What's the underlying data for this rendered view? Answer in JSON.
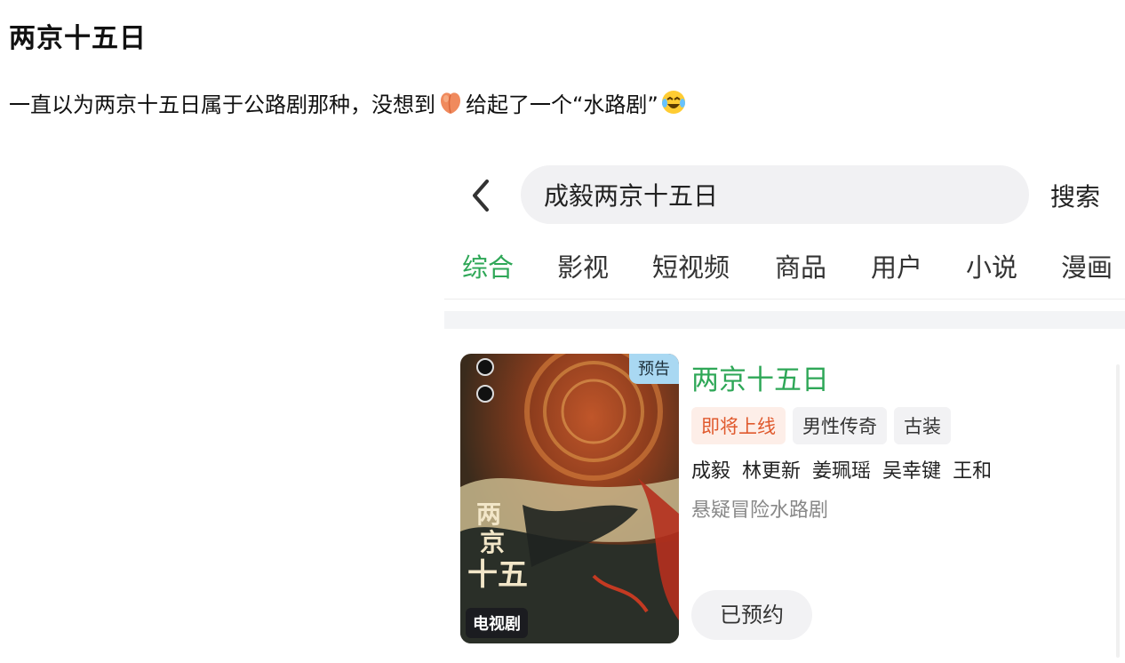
{
  "post": {
    "title": "两京十五日",
    "body_part1": "一直以为两京十五日属于公路剧那种，没想到",
    "body_part2": "给起了一个“水路剧”"
  },
  "search": {
    "query": "成毅两京十五日",
    "button_label": "搜索"
  },
  "tabs": [
    {
      "label": "综合",
      "active": true
    },
    {
      "label": "影视"
    },
    {
      "label": "短视频"
    },
    {
      "label": "商品"
    },
    {
      "label": "用户"
    },
    {
      "label": "小说"
    },
    {
      "label": "漫画"
    }
  ],
  "result": {
    "title": "两京十五日",
    "poster_badge": "预告",
    "poster_type": "电视剧",
    "tags": [
      "即将上线",
      "男性传奇",
      "古装"
    ],
    "cast": [
      "成毅",
      "林更新",
      "姜珮瑶",
      "吴幸键",
      "王和"
    ],
    "genre": "悬疑冒险水路剧",
    "reserve_label": "已预约"
  },
  "colors": {
    "accent_green": "#2ea757",
    "upcoming_orange": "#e05a2e",
    "trailer_badge": "#a9d8f2"
  },
  "icons": [
    "peach-emoji-icon",
    "laughing-emoji-icon",
    "back-chevron-icon"
  ]
}
